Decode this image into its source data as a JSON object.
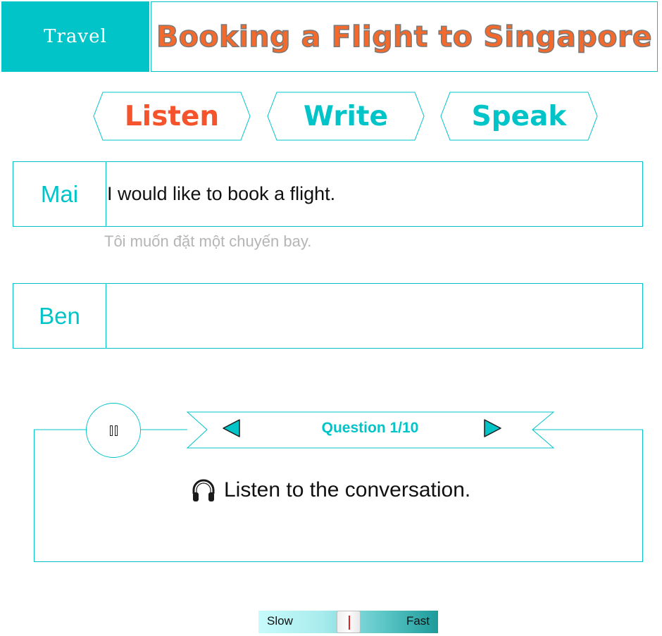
{
  "header": {
    "topic": "Travel",
    "title": "Booking a Flight to Singapore"
  },
  "tabs": [
    {
      "label": "Listen",
      "color": "#f4532b",
      "active": true
    },
    {
      "label": "Write",
      "color": "#00c4c8",
      "active": false
    },
    {
      "label": "Speak",
      "color": "#00c4c8",
      "active": false
    }
  ],
  "dialogue": [
    {
      "speaker": "Mai",
      "line": "I would like to book a flight.",
      "translation": "Tôi muốn đặt một chuyến bay."
    },
    {
      "speaker": "Ben",
      "line": "",
      "translation": ""
    }
  ],
  "question": {
    "counter": "Question 1/10",
    "instruction": "Listen to the conversation."
  },
  "icons": {
    "pause": "pause-icon",
    "prev": "triangle-left-icon",
    "next": "triangle-right-icon",
    "instruction": "headphones-icon"
  },
  "speed": {
    "slow_label": "Slow",
    "fast_label": "Fast",
    "value": 0.5
  },
  "colors": {
    "accent": "#00c4c8",
    "title": "#f36a2c",
    "listen": "#f4532b",
    "translation": "#b5b5b5"
  }
}
